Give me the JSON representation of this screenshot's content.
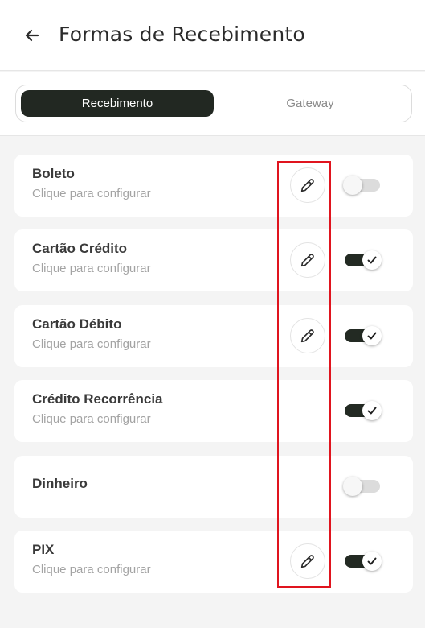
{
  "header": {
    "title": "Formas de Recebimento",
    "back_icon": "arrow-left-icon"
  },
  "tabs": [
    {
      "label": "Recebimento",
      "active": true
    },
    {
      "label": "Gateway",
      "active": false
    }
  ],
  "items": [
    {
      "title": "Boleto",
      "subtitle": "Clique para configurar",
      "editable": true,
      "enabled": false
    },
    {
      "title": "Cartão Crédito",
      "subtitle": "Clique para configurar",
      "editable": true,
      "enabled": true
    },
    {
      "title": "Cartão Débito",
      "subtitle": "Clique para configurar",
      "editable": true,
      "enabled": true
    },
    {
      "title": "Crédito Recorrência",
      "subtitle": "Clique para configurar",
      "editable": false,
      "enabled": true
    },
    {
      "title": "Dinheiro",
      "subtitle": "",
      "editable": false,
      "enabled": false
    },
    {
      "title": "PIX",
      "subtitle": "Clique para configurar",
      "editable": true,
      "enabled": true
    }
  ],
  "colors": {
    "accent_dark": "#222822",
    "highlight": "#e0141e",
    "background": "#f4f4f4"
  },
  "icons": {
    "edit": "pencil-icon",
    "check": "check-icon"
  }
}
